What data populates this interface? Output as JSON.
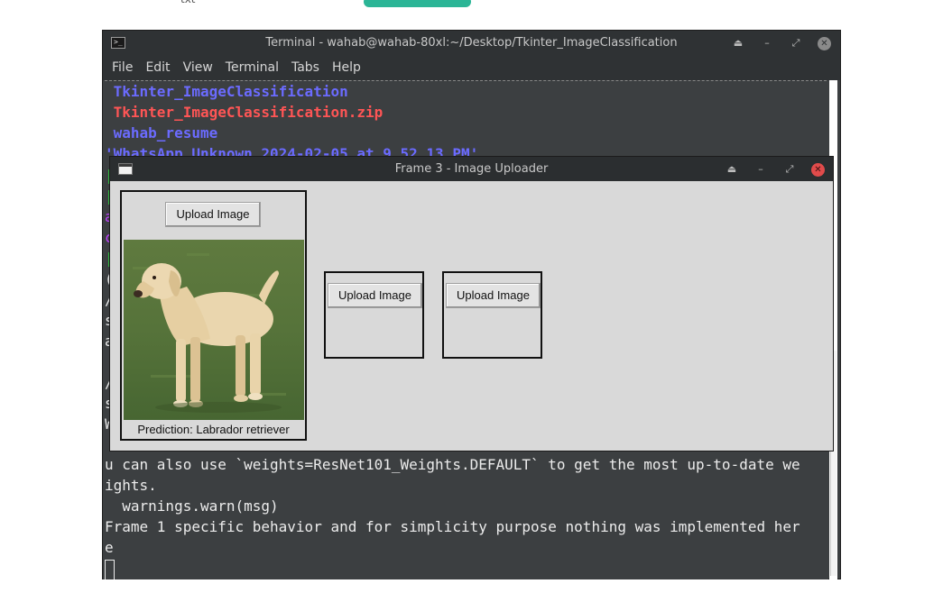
{
  "background": {
    "partial_text": "txt"
  },
  "terminal": {
    "title": "Terminal - wahab@wahab-80xl:~/Desktop/Tkinter_ImageClassification",
    "menu": [
      "File",
      "Edit",
      "View",
      "Terminal",
      "Tabs",
      "Help"
    ],
    "lines_top": [
      {
        "text": " Tkinter_ImageClassification",
        "color": "blue"
      },
      {
        "text": " Tkinter_ImageClassification.zip",
        "color": "red"
      },
      {
        "text": " wahab_resume",
        "color": "blue"
      },
      {
        "text": "'WhatsApp Unknown 2024-02-05 at 9.52.13 PM'",
        "color": "blue"
      }
    ],
    "lines_bottom": [
      "u can also use `weights=ResNet101_Weights.DEFAULT` to get the most up-to-date we",
      "ights.",
      "  warnings.warn(msg)",
      "Frame 1 specific behavior and for simplicity purpose nothing was implemented her",
      "e"
    ],
    "stubs": [
      {
        "text": "|",
        "color": "#2ecc40"
      },
      {
        "text": "|",
        "color": "#2ecc40"
      },
      {
        "text": "a",
        "color": "#c040ff"
      },
      {
        "text": "c",
        "color": "#c040ff"
      },
      {
        "text": "|",
        "color": "#2ecc40"
      },
      {
        "text": "(",
        "color": "#ececec"
      },
      {
        "text": "/",
        "color": "#ececec"
      },
      {
        "text": "s",
        "color": "#ececec"
      },
      {
        "text": "a",
        "color": "#ececec"
      },
      {
        "text": "/",
        "color": "#ececec"
      },
      {
        "text": "s",
        "color": "#ececec"
      },
      {
        "text": "W",
        "color": "#ececec"
      }
    ]
  },
  "tk_window": {
    "title": "Frame 3 - Image Uploader",
    "frame1": {
      "button": "Upload Image",
      "prediction": "Prediction: Labrador retriever"
    },
    "frame2": {
      "button": "Upload Image"
    },
    "frame3": {
      "button": "Upload Image"
    }
  },
  "colors": {
    "terminal_bg": "#3c3f41",
    "blue_text": "#6b6bff",
    "red_text": "#ff5555",
    "tk_bg": "#d9d9d9",
    "close_red": "#e04b4b"
  },
  "icons": [
    "terminal-icon",
    "window-icon",
    "eject-icon",
    "minimize-icon",
    "maximize-icon",
    "close-icon"
  ]
}
